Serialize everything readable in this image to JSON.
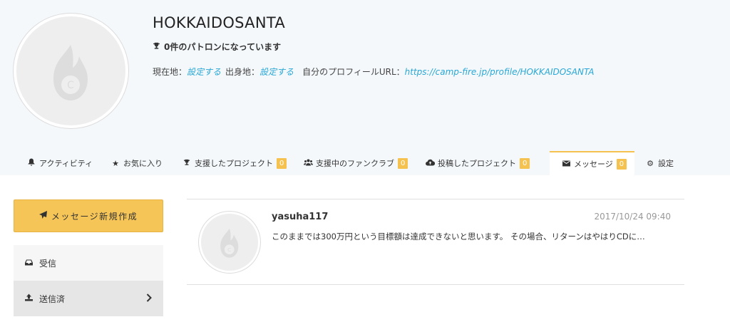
{
  "profile": {
    "username": "HOKKAIDOSANTA",
    "patron_text": "0件のパトロンになっています",
    "location_label": "現在地：",
    "location_value": "設定する",
    "hometown_label": "出身地：",
    "hometown_value": "設定する",
    "url_label": "自分のプロフィールURL：",
    "url_value": "https://camp-fire.jp/profile/HOKKAIDOSANTA"
  },
  "tabs": [
    {
      "label": "アクティビティ",
      "icon": "bell-icon"
    },
    {
      "label": "お気に入り",
      "icon": "star-icon"
    },
    {
      "label": "支援したプロジェクト",
      "icon": "trophy-icon",
      "badge": "0"
    },
    {
      "label": "支援中のファンクラブ",
      "icon": "users-icon",
      "badge": "0"
    },
    {
      "label": "投稿したプロジェクト",
      "icon": "cloud-upload-icon",
      "badge": "0"
    },
    {
      "label": "メッセージ",
      "icon": "envelope-icon",
      "badge": "0",
      "active": true
    },
    {
      "label": "設定",
      "icon": "gear-icon"
    }
  ],
  "sidebar": {
    "compose_label": "メッセージ新規作成",
    "folders": [
      {
        "label": "受信",
        "icon": "inbox-icon"
      },
      {
        "label": "送信済",
        "icon": "upload-icon",
        "selected": true
      }
    ]
  },
  "messages": [
    {
      "sender": "yasuha117",
      "date": "2017/10/24 09:40",
      "preview": "このままでは300万円という目標額は達成できないと思います。 その場合、リターンはやはりCDに…"
    }
  ],
  "colors": {
    "accent": "#f6c557",
    "link": "#2aa7d6",
    "header_bg": "#f4f8fb"
  }
}
